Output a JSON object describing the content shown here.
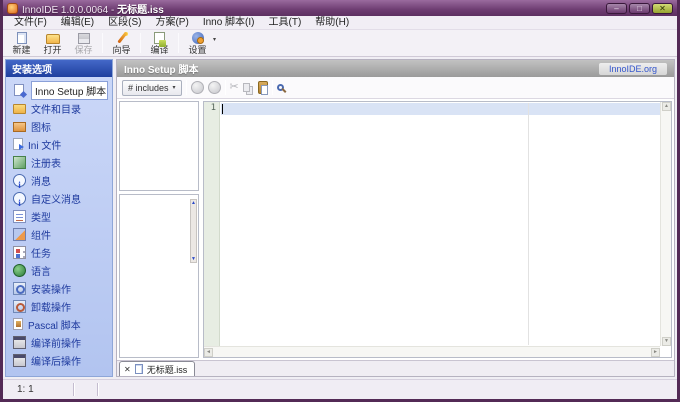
{
  "window": {
    "title_prefix": "InnoIDE 1.0.0.0064 - ",
    "title_doc": "无标题.iss"
  },
  "icons": {
    "minimize_glyph": "–",
    "maximize_glyph": "□",
    "close_glyph": "✕",
    "caret_down": "▾",
    "scissors": "✂",
    "arrow_up": "▲",
    "arrow_down": "▼",
    "arrow_left": "◄",
    "arrow_right": "►",
    "close_tab": "✕"
  },
  "colors": {
    "titlebar": "#6e3d72",
    "sidebar_header": "#2a4dae",
    "link": "#3355cc",
    "line_highlight": "#d9e3f5"
  },
  "menubar": {
    "items": [
      "文件(F)",
      "编辑(E)",
      "区段(S)",
      "方案(P)",
      "Inno 脚本(I)",
      "工具(T)",
      "帮助(H)"
    ]
  },
  "toolbar": {
    "new": "新建",
    "open": "打开",
    "save": "保存",
    "wizard": "向导",
    "compile": "编译",
    "settings": "设置"
  },
  "sidebar": {
    "header": "安装选项",
    "items": [
      {
        "label": "Inno Setup 脚本",
        "selected": true
      },
      {
        "label": "文件和目录"
      },
      {
        "label": "图标"
      },
      {
        "label": "Ini 文件"
      },
      {
        "label": "注册表"
      },
      {
        "label": "消息"
      },
      {
        "label": "自定义消息"
      },
      {
        "label": "类型"
      },
      {
        "label": "组件"
      },
      {
        "label": "任务"
      },
      {
        "label": "语言"
      },
      {
        "label": "安装操作"
      },
      {
        "label": "卸载操作"
      },
      {
        "label": "Pascal 脚本"
      },
      {
        "label": "编译前操作"
      },
      {
        "label": "编译后操作"
      }
    ]
  },
  "main": {
    "header_title": "Inno Setup 脚本",
    "header_link": "InnoIDE.org",
    "includes_label": "# includes",
    "editor": {
      "line_number": "1"
    },
    "tab": {
      "label": "无标题.iss"
    }
  },
  "statusbar": {
    "position": "1: 1"
  }
}
